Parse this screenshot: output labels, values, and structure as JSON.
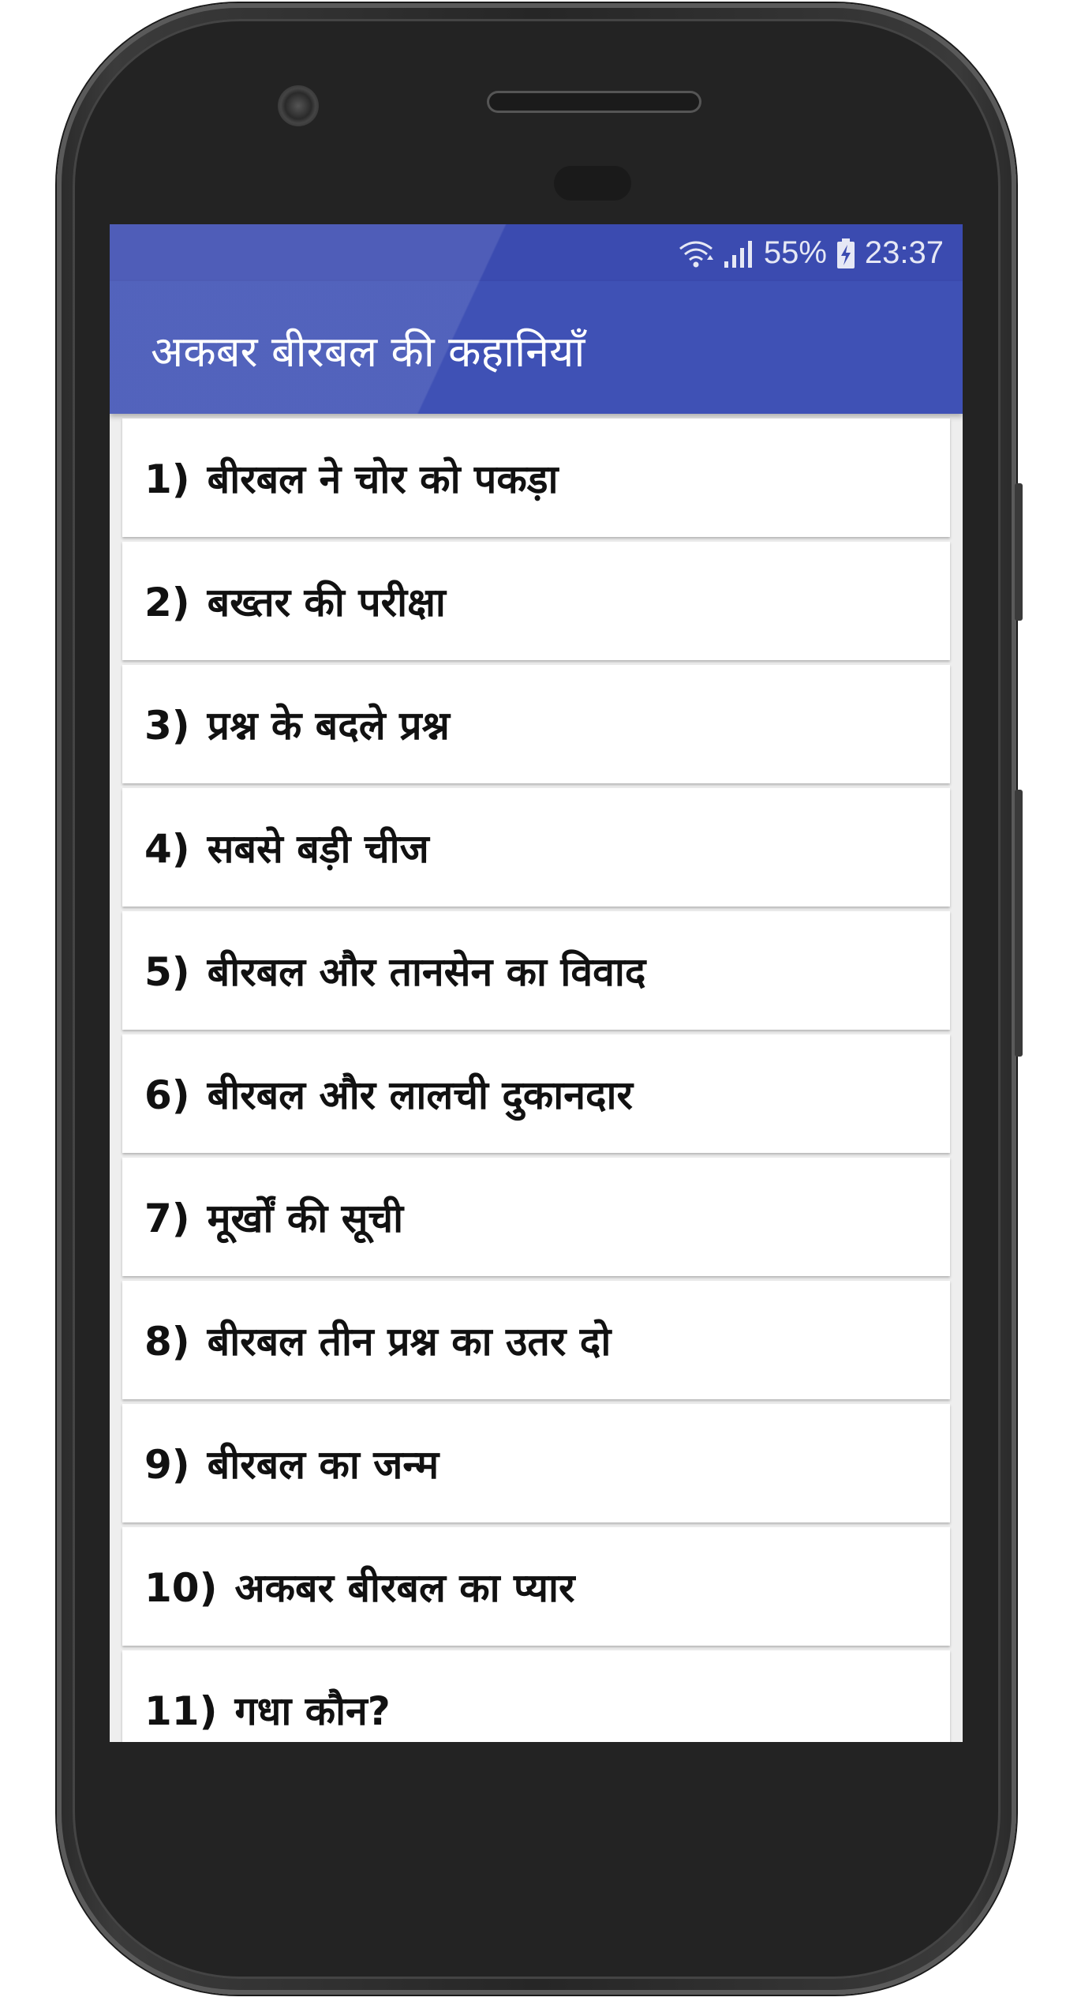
{
  "status_bar": {
    "battery_percent": "55%",
    "time": "23:37",
    "icons": [
      "wifi-icon",
      "signal-icon",
      "battery-charging-icon"
    ]
  },
  "app_bar": {
    "title": "अकबर बीरबल की कहानियाँ"
  },
  "colors": {
    "app_bar": "#3f51b5",
    "status_bar": "#3b4bb0",
    "list_background": "#eeeeee",
    "card": "#ffffff"
  },
  "stories": [
    {
      "number": "1)",
      "title": "बीरबल ने चोर को पकड़ा"
    },
    {
      "number": "2)",
      "title": "बख्तर की परीक्षा"
    },
    {
      "number": "3)",
      "title": "प्रश्न के बदले प्रश्न"
    },
    {
      "number": "4)",
      "title": "सबसे बड़ी चीज"
    },
    {
      "number": "5)",
      "title": "बीरबल और तानसेन का विवाद"
    },
    {
      "number": "6)",
      "title": "बीरबल और लालची दुकानदार"
    },
    {
      "number": "7)",
      "title": "मूर्खों की सूची"
    },
    {
      "number": "8)",
      "title": "बीरबल तीन प्रश्न का उतर दो"
    },
    {
      "number": "9)",
      "title": "बीरबल का जन्म"
    },
    {
      "number": "10)",
      "title": "अकबर बीरबल का प्यार"
    },
    {
      "number": "11)",
      "title": "गधा कौन?"
    }
  ]
}
